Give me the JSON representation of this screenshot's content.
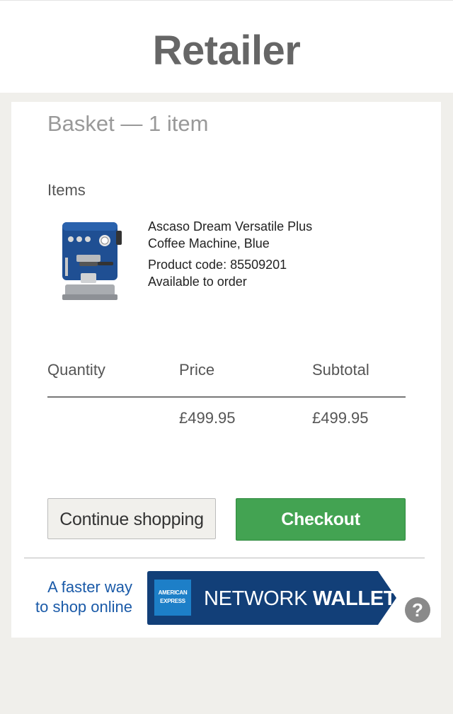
{
  "header": {
    "title": "Retailer"
  },
  "basket": {
    "title": "Basket — 1 item",
    "items_label": "Items",
    "product": {
      "name_line1": "Ascaso Dream Versatile Plus",
      "name_line2": "Coffee Machine, Blue",
      "code": "Product code: 85509201",
      "availability": "Available to order"
    },
    "columns": {
      "quantity": "Quantity",
      "price": "Price",
      "subtotal": "Subtotal"
    },
    "values": {
      "price": "£499.95",
      "subtotal": "£499.95"
    }
  },
  "actions": {
    "continue_label": "Continue shopping",
    "checkout_label": "Checkout"
  },
  "wallet": {
    "tagline_line1": "A faster way",
    "tagline_line2": "to shop online",
    "logo_line1": "AMERICAN",
    "logo_line2": "EXPRESS",
    "label_regular": "NETWORK",
    "label_bold": "WALLET",
    "help_symbol": "?"
  },
  "colors": {
    "checkout": "#43a352",
    "wallet_banner": "#123f78",
    "amex_blue": "#1d7fc8",
    "link_blue": "#1a5aa8"
  },
  "icons": {
    "product": "coffee-machine-image",
    "help": "help-icon",
    "logo": "amex-logo"
  }
}
